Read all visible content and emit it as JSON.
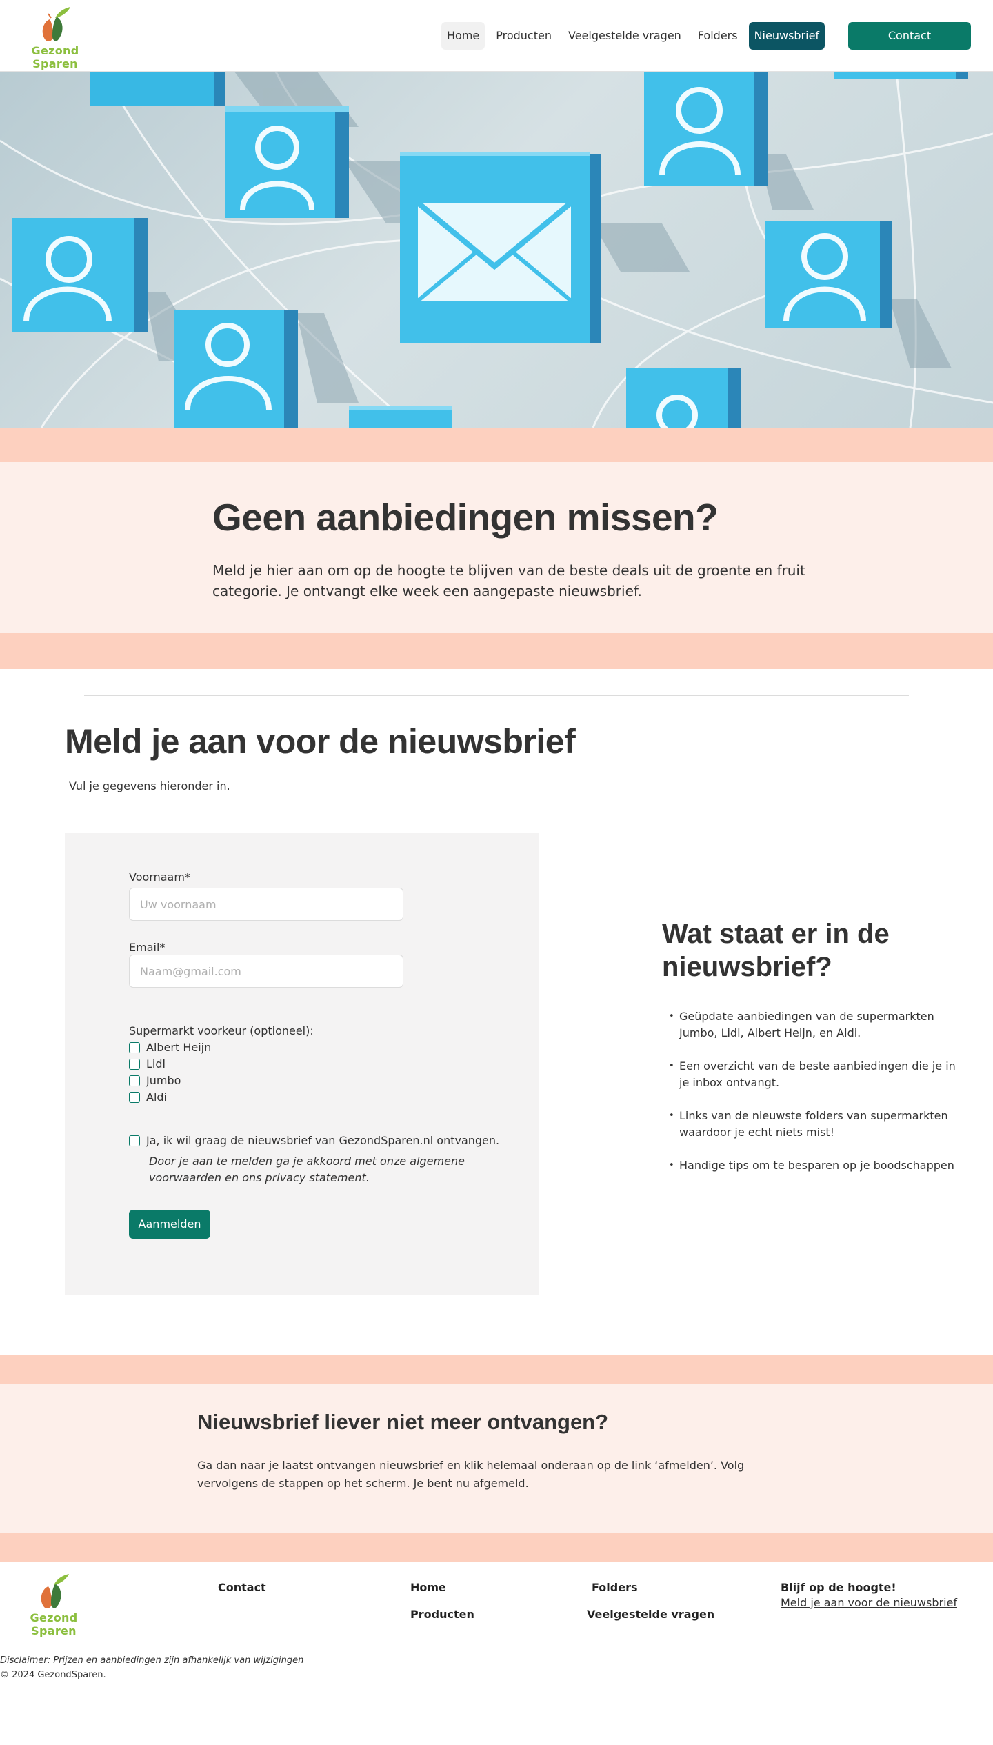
{
  "header": {
    "logo_text": "Gezond Sparen",
    "nav": [
      "Home",
      "Producten",
      "Veelgestelde vragen",
      "Folders",
      "Nieuwsbrief"
    ],
    "contact_label": "Contact"
  },
  "intro": {
    "title": "Geen aanbiedingen missen?",
    "text": "Meld je hier aan om op de hoogte te blijven van de beste deals uit de groente en fruit categorie. Je ontvangt elke week een aangepaste nieuwsbrief."
  },
  "signup": {
    "title": "Meld je aan voor de nieuwsbrief",
    "subtitle": "Vul je gegevens hieronder in.",
    "first_name_label": "Voornaam*",
    "first_name_placeholder": "Uw voornaam",
    "email_label": "Email*",
    "email_placeholder": "Naam@gmail.com",
    "supermarket_label": "Supermarkt voorkeur (optioneel):",
    "supermarkets": [
      "Albert Heijn",
      "Lidl",
      "Jumbo",
      "Aldi"
    ],
    "consent_label": "Ja, ik wil graag de nieuwsbrief van GezondSparen.nl ontvangen.",
    "consent_note": "Door je aan te melden ga je akkoord met onze algemene voorwaarden en ons privacy statement.",
    "submit_label": "Aanmelden"
  },
  "info": {
    "title": "Wat staat er in de nieuwsbrief?",
    "items": [
      "Geüpdate aanbiedingen van de supermarkten Jumbo, Lidl, Albert Heijn, en Aldi.",
      "Een overzicht van de beste aanbiedingen die je in je inbox ontvangt.",
      "Links van de nieuwste folders van supermarkten waardoor je echt niets mist!",
      "Handige tips om te besparen op je boodschappen"
    ]
  },
  "unsubscribe": {
    "title": "Nieuwsbrief liever niet meer ontvangen?",
    "text": "Ga dan naar je laatst ontvangen nieuwsbrief en klik helemaal onderaan op de link ‘afmelden’. Volg vervolgens de stappen op het scherm. Je bent nu afgemeld."
  },
  "footer": {
    "logo_text": "Gezond Sparen",
    "contact": "Contact",
    "home": "Home",
    "producten": "Producten",
    "folders": "Folders",
    "faq": "Veelgestelde vragen",
    "cta_title": "Blijf op de hoogte!",
    "cta_link": "Meld je aan voor de nieuwsbrief",
    "disclaimer": "Disclaimer: Prijzen en aanbiedingen zijn afhankelijk van wijzigingen",
    "copyright": "© 2024 GezondSparen."
  },
  "colors": {
    "brand_green": "#0a7a68",
    "nav_active": "#0c5563",
    "peach": "#fdd0bf",
    "light_peach": "#fdefea",
    "logo_green": "#8cbf3f"
  },
  "icons": [
    "logo-icon",
    "envelope-icon",
    "user-icon"
  ]
}
